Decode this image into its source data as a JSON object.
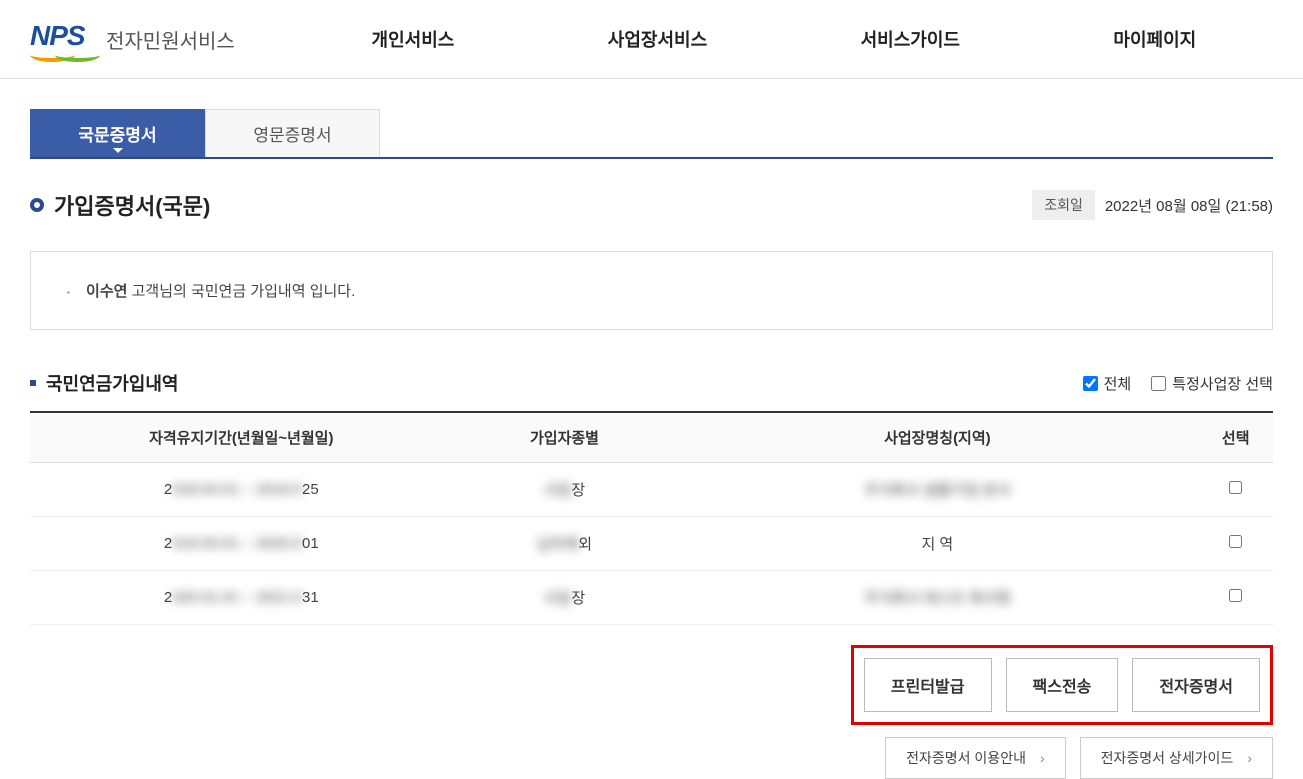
{
  "header": {
    "logo_mark": "NPS",
    "logo_text": "전자민원서비스",
    "nav": [
      "개인서비스",
      "사업장서비스",
      "서비스가이드",
      "마이페이지"
    ]
  },
  "tabs": {
    "active": "국문증명서",
    "inactive": "영문증명서"
  },
  "page": {
    "title": "가입증명서(국문)",
    "date_label": "조회일",
    "date_value": "2022년 08월 08일 (21:58)"
  },
  "info": {
    "user_name": "이수연",
    "message_suffix": " 고객님의 국민연금 가입내역 입니다."
  },
  "section": {
    "title": "국민연금가입내역",
    "filter_all": "전체",
    "filter_specific": "특정사업장 선택"
  },
  "table": {
    "headers": {
      "period": "자격유지기간(년월일~년월일)",
      "type": "가입자종별",
      "workplace": "사업장명칭(지역)",
      "select": "선택"
    },
    "rows": [
      {
        "period_prefix": "2",
        "period_blur": "018.04.01 ~ 2019.0",
        "period_suffix": "25",
        "type_blur": "사업",
        "type_suffix": "장",
        "workplace": "주식회사 샘플기업 본사",
        "workplace_visible": ""
      },
      {
        "period_prefix": "2",
        "period_blur": "019.03.01 ~ 2020.0",
        "period_suffix": "01",
        "type_blur": "납부예",
        "type_suffix": "외",
        "workplace": "",
        "workplace_visible": "지 역"
      },
      {
        "period_prefix": "2",
        "period_blur": "020.01.01 ~ 2021.0",
        "period_suffix": "31",
        "type_blur": "사업",
        "type_suffix": "장",
        "workplace": "주식회사 테스트 회사명",
        "workplace_visible": ""
      }
    ]
  },
  "actions": {
    "print": "프린터발급",
    "fax": "팩스전송",
    "ecert": "전자증명서"
  },
  "guides": {
    "usage": "전자증명서 이용안내",
    "detail": "전자증명서 상세가이드"
  }
}
